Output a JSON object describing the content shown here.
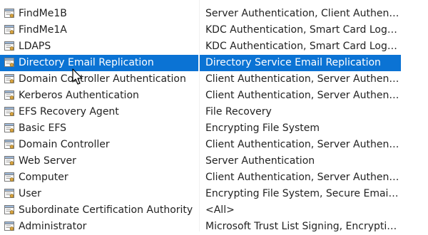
{
  "templates": [
    {
      "name": "FindMe1B",
      "purpose": "Server Authentication, Client Authentic...",
      "selected": false,
      "icon": "certificate-template-icon"
    },
    {
      "name": "FindMe1A",
      "purpose": "KDC Authentication, Smart Card Logon...",
      "selected": false,
      "icon": "certificate-template-icon"
    },
    {
      "name": "LDAPS",
      "purpose": "KDC Authentication, Smart Card Logon...",
      "selected": false,
      "icon": "certificate-template-icon"
    },
    {
      "name": "Directory Email Replication",
      "purpose": "Directory Service Email Replication",
      "selected": true,
      "icon": "certificate-template-icon"
    },
    {
      "name": "Domain Controller Authentication",
      "purpose": "Client Authentication, Server Authentic...",
      "selected": false,
      "icon": "certificate-template-icon"
    },
    {
      "name": "Kerberos Authentication",
      "purpose": "Client Authentication, Server Authentic...",
      "selected": false,
      "icon": "certificate-template-icon"
    },
    {
      "name": "EFS Recovery Agent",
      "purpose": "File Recovery",
      "selected": false,
      "icon": "certificate-template-icon"
    },
    {
      "name": "Basic EFS",
      "purpose": "Encrypting File System",
      "selected": false,
      "icon": "certificate-template-icon"
    },
    {
      "name": "Domain Controller",
      "purpose": "Client Authentication, Server Authentic...",
      "selected": false,
      "icon": "certificate-template-icon"
    },
    {
      "name": "Web Server",
      "purpose": "Server Authentication",
      "selected": false,
      "icon": "certificate-template-icon"
    },
    {
      "name": "Computer",
      "purpose": "Client Authentication, Server Authentic...",
      "selected": false,
      "icon": "certificate-template-icon"
    },
    {
      "name": "User",
      "purpose": "Encrypting File System, Secure Email, Cl...",
      "selected": false,
      "icon": "certificate-template-icon"
    },
    {
      "name": "Subordinate Certification Authority",
      "purpose": "<All>",
      "selected": false,
      "icon": "certificate-template-icon"
    },
    {
      "name": "Administrator",
      "purpose": "Microsoft Trust List Signing, Encrypting...",
      "selected": false,
      "icon": "certificate-template-icon"
    }
  ],
  "colors": {
    "selection": "#0b73d4",
    "text": "#222222"
  },
  "cursor_icon": "mouse-pointer-icon"
}
